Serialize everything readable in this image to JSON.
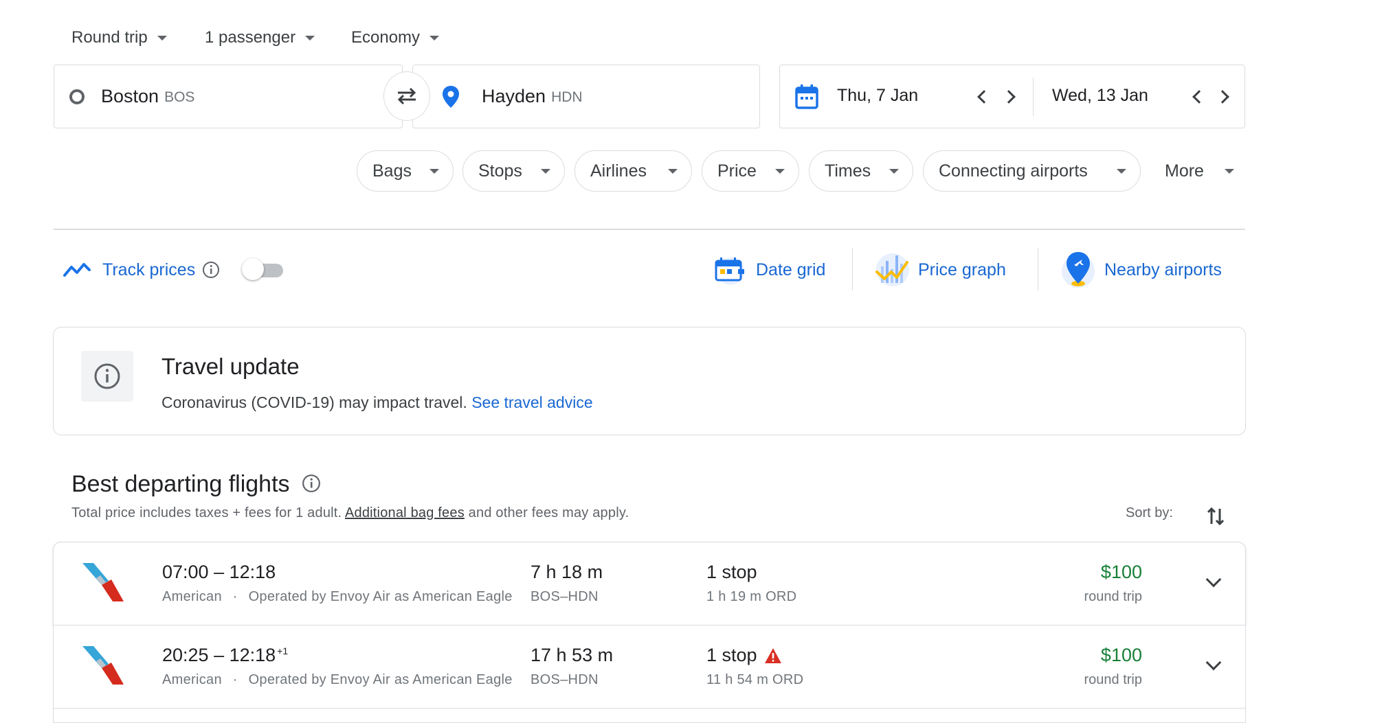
{
  "search": {
    "trip_type": "Round trip",
    "passengers": "1 passenger",
    "cabin": "Economy",
    "origin": {
      "city": "Boston",
      "code": "BOS"
    },
    "destination": {
      "city": "Hayden",
      "code": "HDN"
    },
    "depart_date": "Thu, 7 Jan",
    "return_date": "Wed, 13 Jan"
  },
  "filters": [
    "Bags",
    "Stops",
    "Airlines",
    "Price",
    "Times",
    "Connecting airports",
    "More"
  ],
  "tools": {
    "track_prices": "Track prices",
    "track_prices_on": false,
    "date_grid": "Date grid",
    "price_graph": "Price graph",
    "nearby_airports": "Nearby airports"
  },
  "travel_update": {
    "title": "Travel update",
    "text": "Coronavirus (COVID-19) may impact travel.",
    "link": "See travel advice"
  },
  "results": {
    "title": "Best departing flights",
    "subtitle_pre": "Total price includes taxes + fees for 1 adult.",
    "subtitle_link": "Additional bag fees",
    "subtitle_post": "and other fees may apply.",
    "sort_label": "Sort by:",
    "flights": [
      {
        "times": "07:00 – 12:18",
        "day_offset": "",
        "airline": "American",
        "operated": "Operated by Envoy Air as American Eagle",
        "duration": "7 h 18 m",
        "route": "BOS–HDN",
        "stops": "1 stop",
        "warning": false,
        "layover": "1 h 19 m ORD",
        "price": "$100",
        "price_note": "round trip"
      },
      {
        "times": "20:25 – 12:18",
        "day_offset": "+1",
        "airline": "American",
        "operated": "Operated by Envoy Air as American Eagle",
        "duration": "17 h 53 m",
        "route": "BOS–HDN",
        "stops": "1 stop",
        "warning": true,
        "layover": "11 h 54 m ORD",
        "price": "$100",
        "price_note": "round trip"
      }
    ]
  },
  "colors": {
    "accent_blue": "#1a73e8",
    "link_blue": "#1967d2",
    "price_green": "#188038",
    "warning_red": "#d93025",
    "border": "#dadce0"
  }
}
